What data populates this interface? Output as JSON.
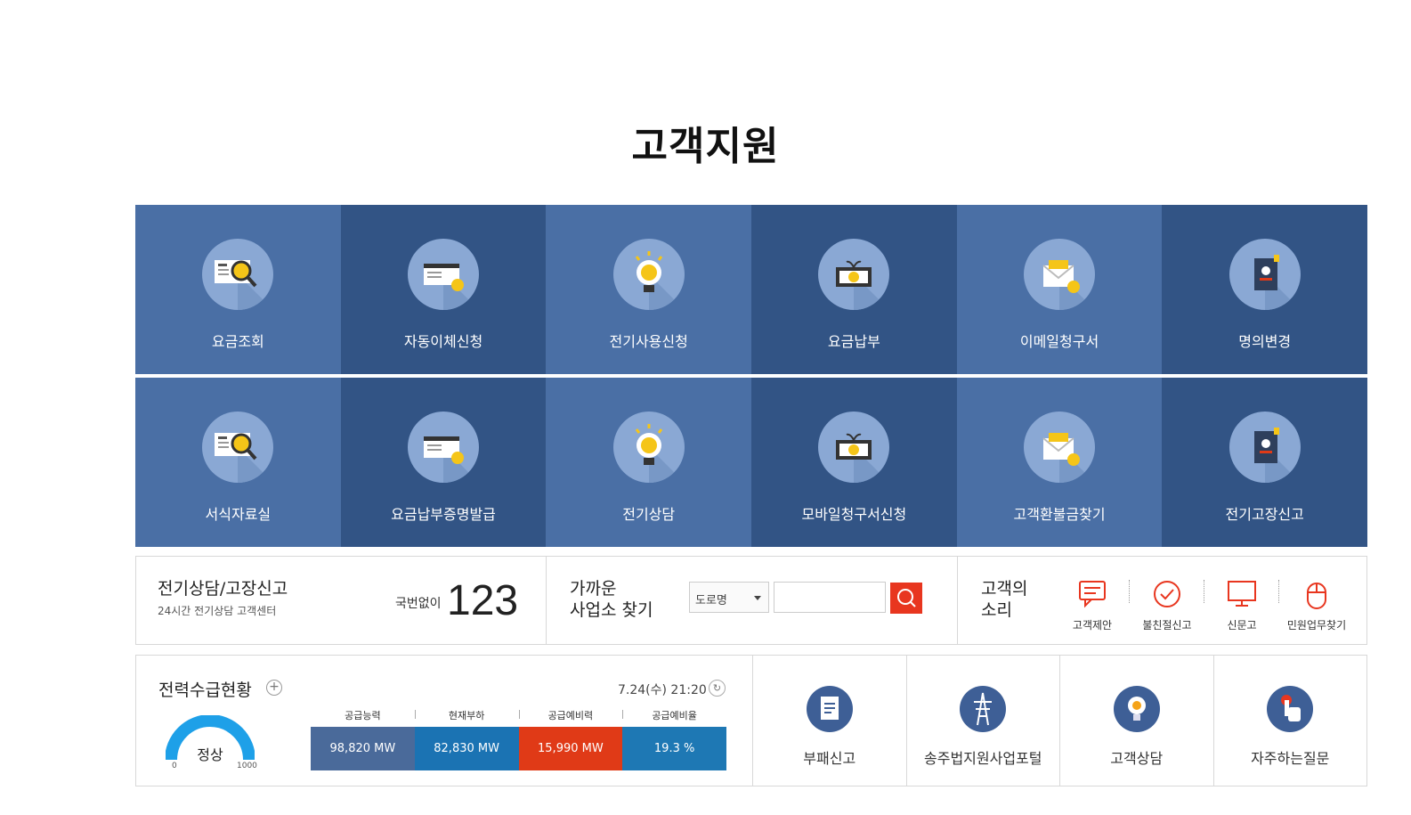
{
  "page": {
    "title": "고객지원"
  },
  "tiles_row1": [
    {
      "label": "요금조회",
      "icon": "bill-search-icon"
    },
    {
      "label": "자동이체신청",
      "icon": "auto-transfer-icon"
    },
    {
      "label": "전기사용신청",
      "icon": "lightbulb-won-icon"
    },
    {
      "label": "요금납부",
      "icon": "payment-icon"
    },
    {
      "label": "이메일청구서",
      "icon": "email-bill-icon"
    },
    {
      "label": "명의변경",
      "icon": "passport-icon"
    }
  ],
  "tiles_row2": [
    {
      "label": "서식자료실",
      "icon": "bill-search-icon"
    },
    {
      "label": "요금납부증명발급",
      "icon": "auto-transfer-icon"
    },
    {
      "label": "전기상담",
      "icon": "lightbulb-won-icon"
    },
    {
      "label": "모바일청구서신청",
      "icon": "payment-icon"
    },
    {
      "label": "고객환불금찾기",
      "icon": "email-bill-icon"
    },
    {
      "label": "전기고장신고",
      "icon": "passport-icon"
    }
  ],
  "consult": {
    "title": "전기상담/고장신고",
    "subtitle": "24시간 전기상담 고객센터",
    "prefix": "국번없이",
    "number": "123"
  },
  "find_office": {
    "title_line1": "가까운",
    "title_line2": "사업소 찾기",
    "select_value": "도로명"
  },
  "voice": {
    "title_line1": "고객의",
    "title_line2": "소리",
    "items": [
      {
        "label": "고객제안",
        "icon": "speech-bubble-icon"
      },
      {
        "label": "불친절신고",
        "icon": "check-circle-icon"
      },
      {
        "label": "신문고",
        "icon": "monitor-icon"
      },
      {
        "label": "민원업무찾기",
        "icon": "mouse-icon"
      }
    ]
  },
  "power": {
    "title": "전력수급현황",
    "time": "7.24(수) 21:20",
    "status": "정상",
    "gauge_min": "0",
    "gauge_max": "1000",
    "headers": [
      "공급능력",
      "현재부하",
      "공급예비력",
      "공급예비율"
    ],
    "values": [
      "98,820 MW",
      "82,830 MW",
      "15,990 MW",
      "19.3 %"
    ],
    "colors": [
      "#4a6a9a",
      "#1b73b3",
      "#e03a17",
      "#1e78b4"
    ]
  },
  "quick_links": [
    {
      "label": "부패신고",
      "icon": "document-icon"
    },
    {
      "label": "송주법지원사업포털",
      "icon": "transmission-tower-icon"
    },
    {
      "label": "고객상담",
      "icon": "lightbulb-icon"
    },
    {
      "label": "자주하는질문",
      "icon": "hand-pointer-icon"
    }
  ]
}
